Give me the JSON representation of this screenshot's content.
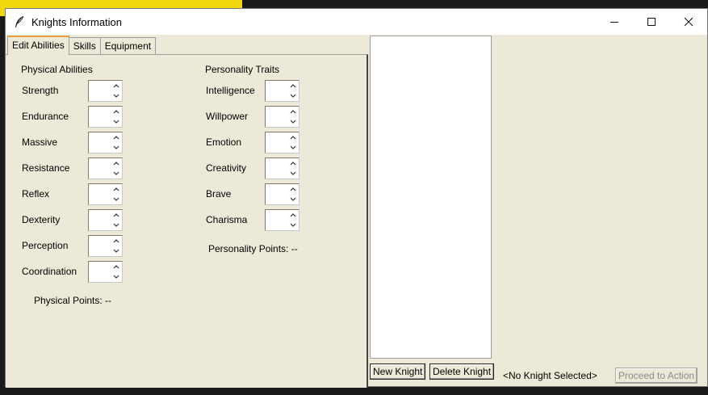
{
  "window": {
    "title": "Knights Information",
    "icon": "feather-icon",
    "controls": [
      "minimize-icon",
      "maximize-icon",
      "close-icon"
    ]
  },
  "tabs": [
    {
      "label": "Edit Abilities",
      "active": true
    },
    {
      "label": "Skills",
      "active": false
    },
    {
      "label": "Equipment",
      "active": false
    }
  ],
  "physical": {
    "title": "Physical Abilities",
    "fields": [
      {
        "label": "Strength",
        "value": ""
      },
      {
        "label": "Endurance",
        "value": ""
      },
      {
        "label": "Massive",
        "value": ""
      },
      {
        "label": "Resistance",
        "value": ""
      },
      {
        "label": "Reflex",
        "value": ""
      },
      {
        "label": "Dexterity",
        "value": ""
      },
      {
        "label": "Perception",
        "value": ""
      },
      {
        "label": "Coordination",
        "value": ""
      }
    ],
    "points_label": "Physical Points: --"
  },
  "personality": {
    "title": "Personality Traits",
    "fields": [
      {
        "label": "Intelligence",
        "value": ""
      },
      {
        "label": "Willpower",
        "value": ""
      },
      {
        "label": "Emotion",
        "value": ""
      },
      {
        "label": "Creativity",
        "value": ""
      },
      {
        "label": "Brave",
        "value": ""
      },
      {
        "label": "Charisma",
        "value": ""
      }
    ],
    "points_label": "Personality Points: --"
  },
  "knights_list": {
    "items": []
  },
  "buttons": {
    "new_knight": "New Knight",
    "delete_knight": "Delete Knight",
    "proceed": "Proceed to Action"
  },
  "status": {
    "selected": "<No Knight Selected>"
  },
  "colors": {
    "background": "#ece9d8",
    "active_tab_accent": "#e6a23c",
    "desktop_yellow": "#f2d80f"
  }
}
